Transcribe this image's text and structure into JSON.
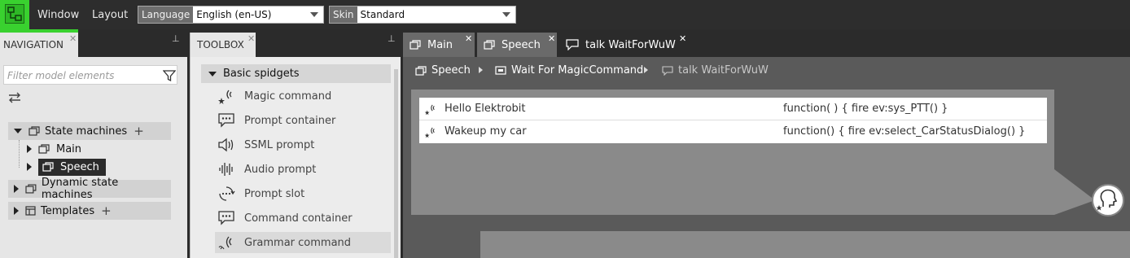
{
  "menu": {
    "window": "Window",
    "layout": "Layout"
  },
  "language": {
    "label": "Language",
    "value": "English (en-US)"
  },
  "skin": {
    "label": "Skin",
    "value": "Standard"
  },
  "navigation": {
    "tab_label": "NAVIGATION",
    "filter_placeholder": "Filter model elements",
    "tree": {
      "state_machines": "State machines",
      "main": "Main",
      "speech": "Speech",
      "dynamic_state_machines": "Dynamic state machines",
      "templates": "Templates"
    }
  },
  "toolbox": {
    "tab_label": "TOOLBOX",
    "category": "Basic spidgets",
    "items": [
      {
        "label": "Magic command",
        "icon": "magic-command-icon"
      },
      {
        "label": "Prompt container",
        "icon": "prompt-container-icon"
      },
      {
        "label": "SSML prompt",
        "icon": "speaker-icon"
      },
      {
        "label": "Audio prompt",
        "icon": "audio-wave-icon"
      },
      {
        "label": "Prompt slot",
        "icon": "prompt-slot-icon"
      },
      {
        "label": "Command container",
        "icon": "command-container-icon"
      },
      {
        "label": "Grammar command",
        "icon": "grammar-command-icon"
      }
    ]
  },
  "editor": {
    "tabs": [
      {
        "label": "Main"
      },
      {
        "label": "Speech"
      },
      {
        "label": "talk WaitForWuW"
      }
    ],
    "breadcrumb": {
      "speech": "Speech",
      "wait": "Wait For MagicCommand",
      "talk": "talk WaitForWuW"
    },
    "grammar_rows": [
      {
        "name": "Hello Elektrobit",
        "function": "function( ) {  fire ev:sys_PTT() }"
      },
      {
        "name": "Wakeup my car",
        "function": "function() {   fire ev:select_CarStatusDialog() }"
      }
    ]
  },
  "colors": {
    "accent_green": "#39d12f",
    "selected_dark": "#2b2b2b",
    "editor_bg": "#5a5a5a",
    "box_gray": "#8a8a8a"
  }
}
